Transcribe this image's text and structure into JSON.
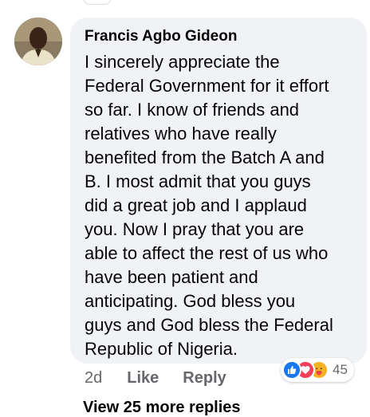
{
  "comment": {
    "author": "Francis Agbo Gideon",
    "text": "I sincerely appreciate the\nFederal Government for it effort\nso far. I know of friends and\nrelatives who have really\nbenefited from the Batch A and\nB. I most admit that you guys\ndid a great job and I applaud\nyou. Now I pray that you are\nable to affect the rest of us who\nhave been patient and\nanticipating. God bless you\nguys and God bless the Federal\nRepublic of Nigeria.",
    "timestamp": "2d",
    "like_label": "Like",
    "reply_label": "Reply",
    "reactions": {
      "icons": [
        "like-icon",
        "love-icon",
        "care-icon"
      ],
      "count": "45"
    }
  },
  "more_replies": "View 25 more replies",
  "colors": {
    "bubble": "#f0f2f5",
    "text": "#050505",
    "secondary": "#65676b",
    "like": "#1877f2",
    "love": "#f33e58",
    "care": "#f7b125"
  }
}
